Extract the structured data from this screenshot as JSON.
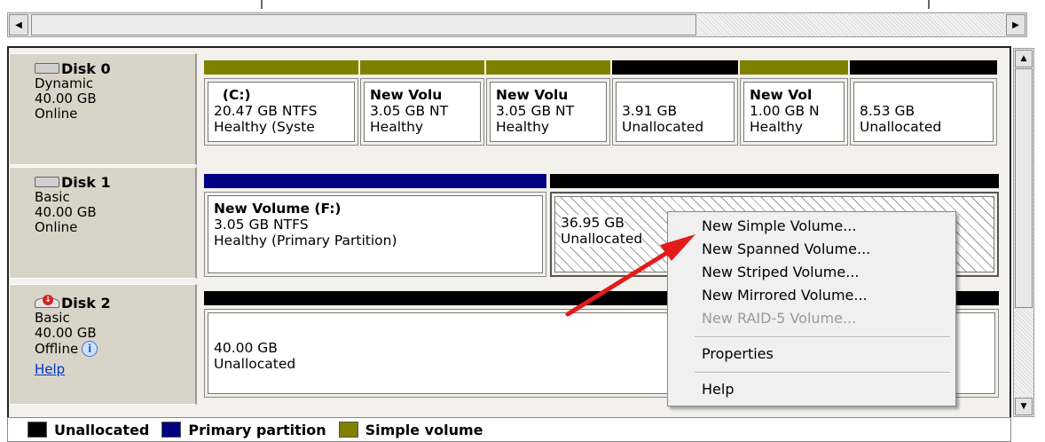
{
  "disks": [
    {
      "name": "Disk 0",
      "type": "Dynamic",
      "size": "40.00 GB",
      "status": "Online",
      "partitions": [
        {
          "bar_color": "#808000",
          "line1": "(C:)",
          "line2": "20.47 GB NTFS",
          "line3": "Healthy (Syste"
        },
        {
          "bar_color": "#808000",
          "line1": "New Volu",
          "line2": "3.05 GB NT",
          "line3": "Healthy"
        },
        {
          "bar_color": "#808000",
          "line1": "New Volu",
          "line2": "3.05 GB NT",
          "line3": "Healthy"
        },
        {
          "bar_color": "#000000",
          "line1": "",
          "line2": "3.91 GB",
          "line3": "Unallocated"
        },
        {
          "bar_color": "#808000",
          "line1": "New Vol",
          "line2": "1.00 GB N",
          "line3": "Healthy"
        },
        {
          "bar_color": "#000000",
          "line1": "",
          "line2": "8.53 GB",
          "line3": "Unallocated"
        }
      ]
    },
    {
      "name": "Disk 1",
      "type": "Basic",
      "size": "40.00 GB",
      "status": "Online",
      "partitions": [
        {
          "bar_color": "#000080",
          "line1": "New Volume  (F:)",
          "line2": "3.05 GB NTFS",
          "line3": "Healthy (Primary Partition)"
        },
        {
          "bar_color": "#000000",
          "line1": "",
          "line2": "36.95 GB",
          "line3": "Unallocated"
        }
      ]
    },
    {
      "name": "Disk 2",
      "type": "Basic",
      "size": "40.00 GB",
      "status": "Offline",
      "help": "Help",
      "partitions": [
        {
          "bar_color": "#000000",
          "line1": "",
          "line2": "40.00 GB",
          "line3": "Unallocated"
        }
      ]
    }
  ],
  "context_menu": {
    "items": [
      {
        "label": "New Simple Volume...",
        "enabled": true
      },
      {
        "label": "New Spanned Volume...",
        "enabled": true
      },
      {
        "label": "New Striped Volume...",
        "enabled": true
      },
      {
        "label": "New Mirrored Volume...",
        "enabled": true
      },
      {
        "label": "New RAID-5 Volume...",
        "enabled": false
      },
      {
        "label": "Properties",
        "enabled": true
      },
      {
        "label": "Help",
        "enabled": true
      }
    ]
  },
  "legend": [
    {
      "label": "Unallocated",
      "color": "#000000"
    },
    {
      "label": "Primary partition",
      "color": "#000080"
    },
    {
      "label": "Simple volume",
      "color": "#808000"
    }
  ],
  "colors": {
    "arrow": "#e31b1b"
  },
  "icons": [
    "disk-icon",
    "offline-disk-icon",
    "info-icon",
    "scroll-left-icon",
    "scroll-right-icon",
    "scroll-up-icon",
    "scroll-down-icon"
  ]
}
